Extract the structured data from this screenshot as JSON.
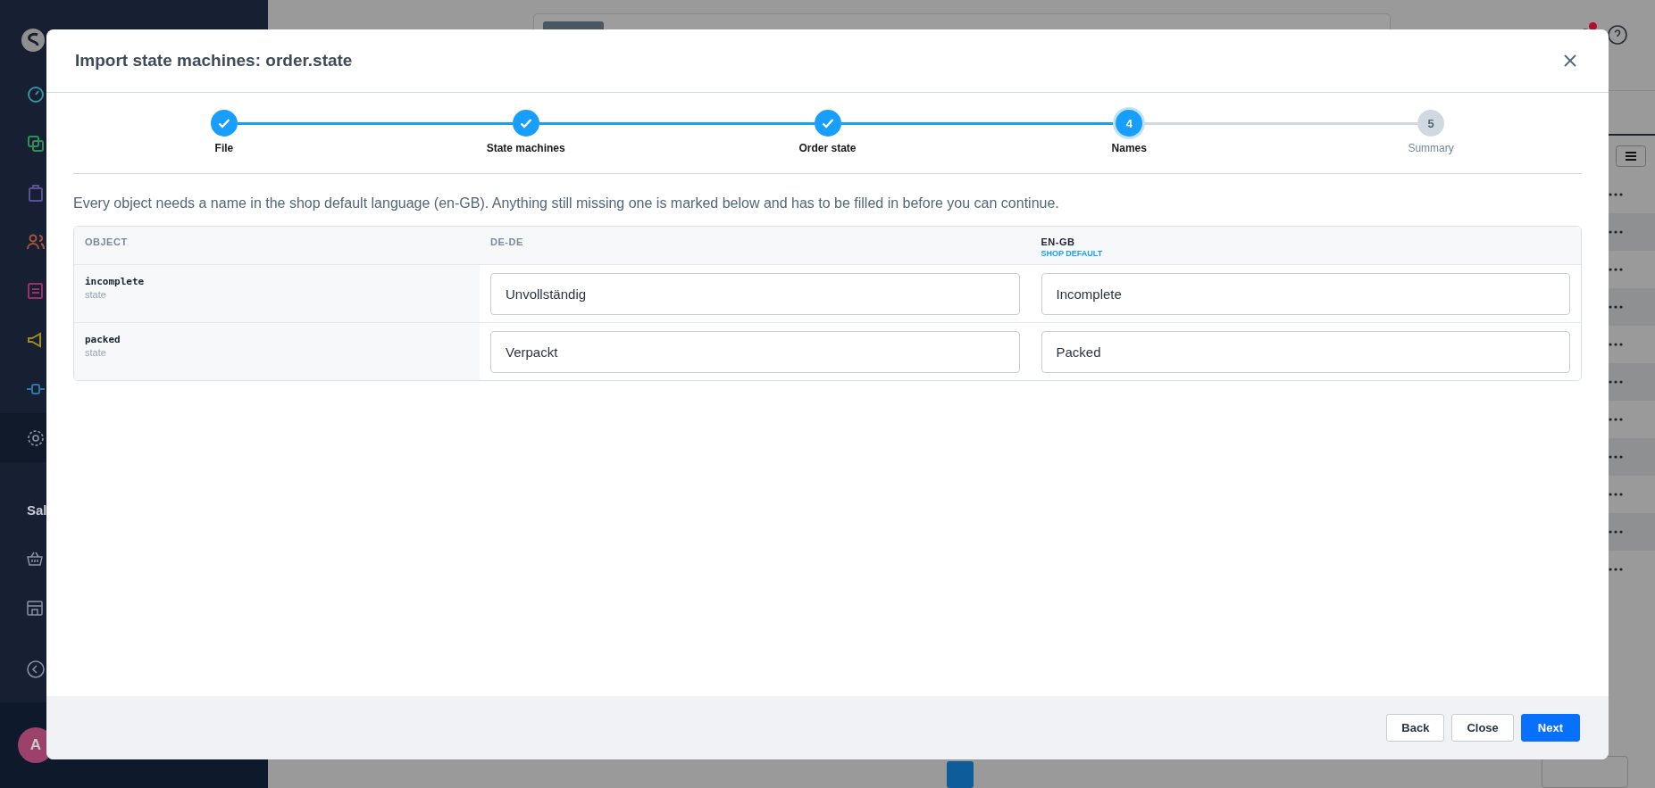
{
  "background": {
    "sidebar": {
      "section_label": "Sal",
      "avatar_initial": "A"
    }
  },
  "modal": {
    "title": "Import state machines: order.state",
    "steps": [
      {
        "label": "File",
        "kind": "done"
      },
      {
        "label": "State machines",
        "kind": "done"
      },
      {
        "label": "Order state",
        "kind": "done"
      },
      {
        "number": "4",
        "label": "Names",
        "kind": "active"
      },
      {
        "number": "5",
        "label": "Summary",
        "kind": "pending"
      }
    ],
    "description": "Every object needs a name in the shop default language (en-GB). Anything still missing one is marked below and has to be filled in before you can continue.",
    "table": {
      "columns": [
        {
          "label": "OBJECT"
        },
        {
          "label": "DE-DE"
        },
        {
          "label": "EN-GB",
          "note": "SHOP DEFAULT"
        }
      ],
      "rows": [
        {
          "name": "incomplete",
          "type": "state",
          "values": [
            "Unvollständig",
            "Incomplete"
          ]
        },
        {
          "name": "packed",
          "type": "state",
          "values": [
            "Verpackt",
            "Packed"
          ]
        }
      ]
    },
    "buttons": [
      {
        "label": "Back",
        "kind": "secondary"
      },
      {
        "label": "Close",
        "kind": "secondary"
      },
      {
        "label": "Next",
        "kind": "primary"
      }
    ]
  }
}
